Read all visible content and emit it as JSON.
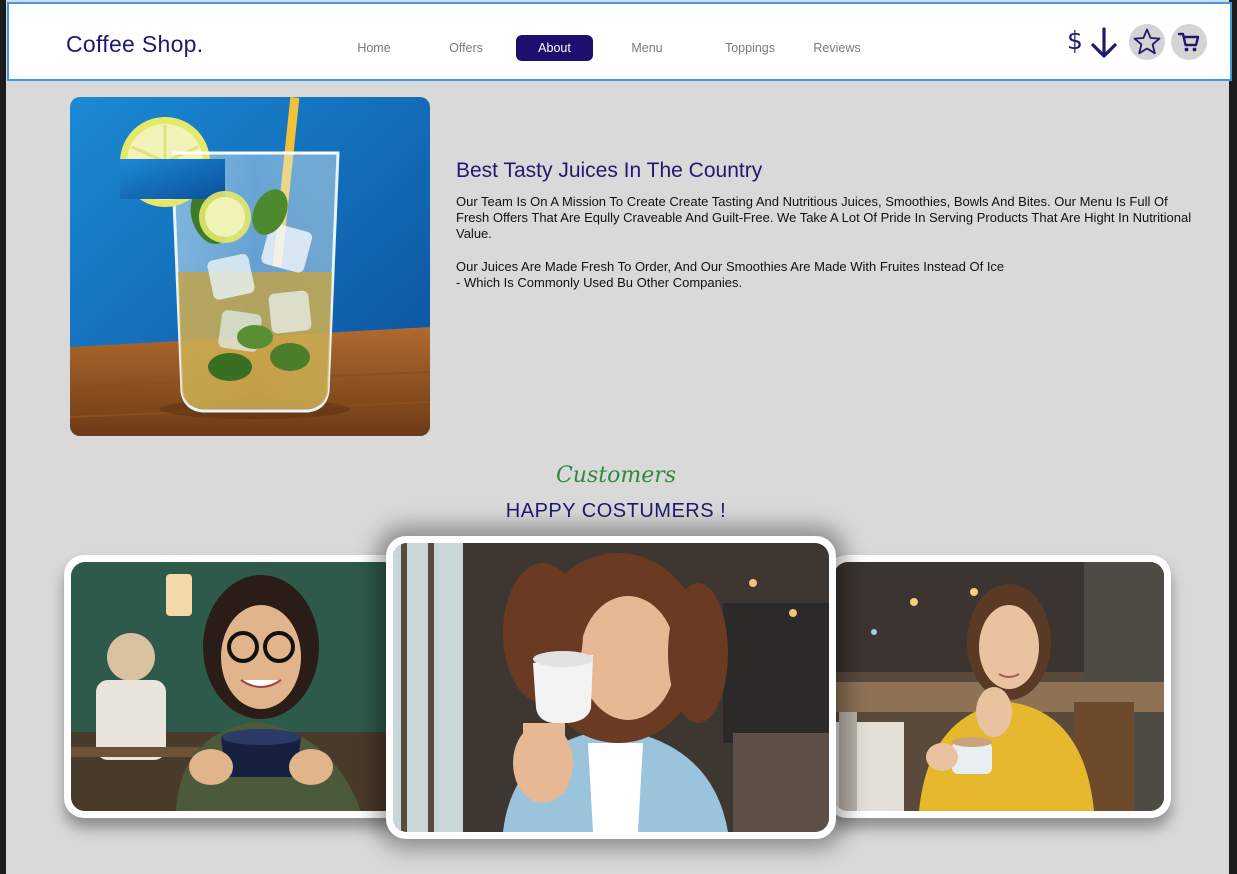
{
  "header": {
    "logo": "Coffee Shop.",
    "nav": [
      "Home",
      "Offers",
      "About",
      "Menu",
      "Toppings",
      "Reviews"
    ],
    "active_nav": "About",
    "currency_symbol": "$"
  },
  "icons": {
    "sort": "arrow-down-icon",
    "favorites": "star-icon",
    "cart": "cart-icon"
  },
  "about": {
    "title": "Best Tasty Juices In The Country",
    "paragraph1": "Our Team Is On A Mission To Create Create Tasting And Nutritious Juices, Smoothies, Bowls And Bites. Our Menu Is Full Of Fresh Offers That Are Eqully Craveable And Guilt-Free. We Take A Lot Of Pride In Serving Products That  Are Hight In Nutritional Value.",
    "paragraph2_line1": "Our Juices Are Made Fresh To Order, And Our Smoothies Are Made With Fruites Instead Of Ice",
    "paragraph2_line2": "- Which Is Commonly Used Bu Other Companies."
  },
  "customers": {
    "script_label": "Customers",
    "title": "HAPPY COSTUMERS !"
  },
  "colors": {
    "brand": "#1e1b6e",
    "active_nav_bg": "#1c0f6e",
    "header_border": "#3b9be6",
    "script_green": "#2e8b3e",
    "page_bg": "#d9d9d9"
  }
}
